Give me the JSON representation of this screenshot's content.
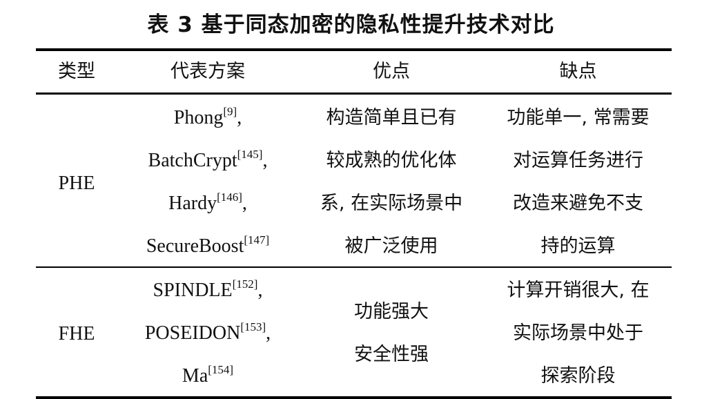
{
  "table": {
    "caption": "表 3 基于同态加密的隐私性提升技术对比",
    "headers": [
      "类型",
      "代表方案",
      "优点",
      "缺点"
    ],
    "rows": [
      {
        "type": "PHE",
        "schemes": [
          {
            "name": "Phong",
            "ref": "[9]",
            "punct": ","
          },
          {
            "name": "BatchCrypt",
            "ref": "[145]",
            "punct": ","
          },
          {
            "name": "Hardy",
            "ref": "[146]",
            "punct": ","
          },
          {
            "name": "SecureBoost",
            "ref": "[147]",
            "punct": ""
          }
        ],
        "advantages": [
          "构造简单且已有",
          "较成熟的优化体",
          "系, 在实际场景中",
          "被广泛使用"
        ],
        "disadvantages": [
          "功能单一, 常需要",
          "对运算任务进行",
          "改造来避免不支",
          "持的运算"
        ]
      },
      {
        "type": "FHE",
        "schemes": [
          {
            "name": "SPINDLE",
            "ref": "[152]",
            "punct": ","
          },
          {
            "name": "POSEIDON",
            "ref": "[153]",
            "punct": ","
          },
          {
            "name": "Ma",
            "ref": "[154]",
            "punct": ""
          }
        ],
        "advantages": [
          "功能强大",
          "安全性强"
        ],
        "disadvantages": [
          "计算开销很大, 在",
          "实际场景中处于",
          "探索阶段"
        ]
      }
    ]
  }
}
